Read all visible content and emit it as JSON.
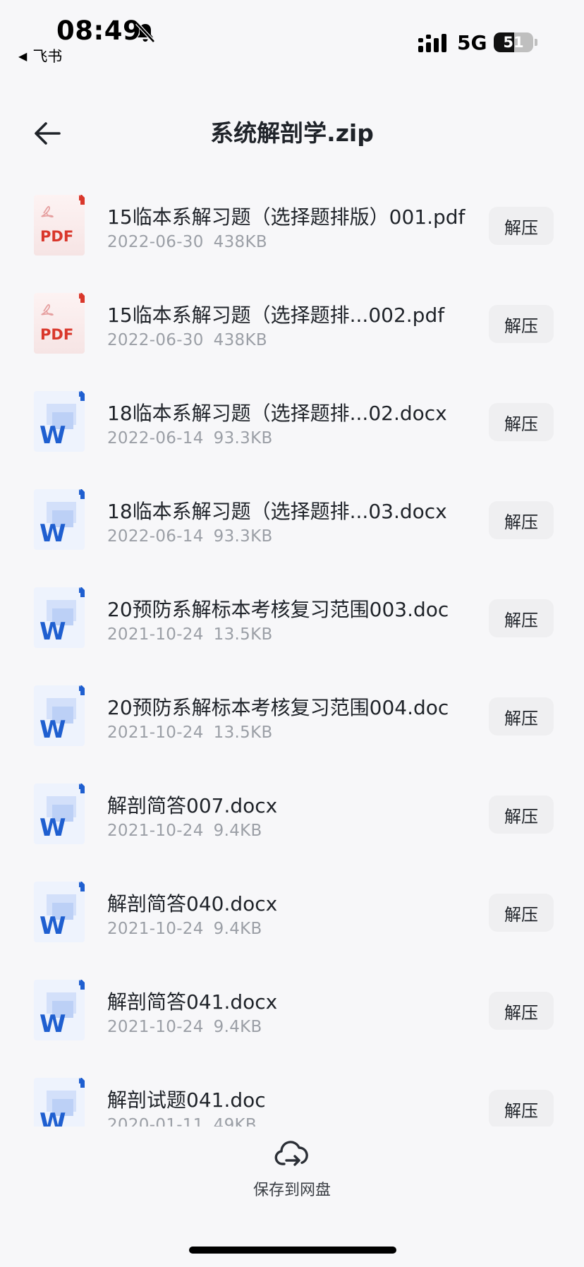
{
  "status_bar": {
    "time": "08:49",
    "back_app": "飞书",
    "network": "5G",
    "battery": "51",
    "battery_level": 0.51
  },
  "header": {
    "title": "系统解剖学.zip"
  },
  "files": [
    {
      "type": "pdf",
      "name": "15临本系解习题（选择题排版）001.pdf",
      "date": "2022-06-30",
      "size": "438KB",
      "action": "解压"
    },
    {
      "type": "pdf",
      "name": "15临本系解习题（选择题排...002.pdf",
      "date": "2022-06-30",
      "size": "438KB",
      "action": "解压"
    },
    {
      "type": "word",
      "name": "18临本系解习题（选择题排...02.docx",
      "date": "2022-06-14",
      "size": "93.3KB",
      "action": "解压"
    },
    {
      "type": "word",
      "name": "18临本系解习题（选择题排...03.docx",
      "date": "2022-06-14",
      "size": "93.3KB",
      "action": "解压"
    },
    {
      "type": "word",
      "name": "20预防系解标本考核复习范围003.doc",
      "date": "2021-10-24",
      "size": "13.5KB",
      "action": "解压"
    },
    {
      "type": "word",
      "name": "20预防系解标本考核复习范围004.doc",
      "date": "2021-10-24",
      "size": "13.5KB",
      "action": "解压"
    },
    {
      "type": "word",
      "name": "解剖简答007.docx",
      "date": "2021-10-24",
      "size": "9.4KB",
      "action": "解压"
    },
    {
      "type": "word",
      "name": "解剖简答040.docx",
      "date": "2021-10-24",
      "size": "9.4KB",
      "action": "解压"
    },
    {
      "type": "word",
      "name": "解剖简答041.docx",
      "date": "2021-10-24",
      "size": "9.4KB",
      "action": "解压"
    },
    {
      "type": "word",
      "name": "解剖试题041.doc",
      "date": "2020-01-11",
      "size": "49KB",
      "action": "解压"
    }
  ],
  "bottom": {
    "save_label": "保存到网盘"
  },
  "icons": {
    "pdf_text": "PDF",
    "word_text": "W"
  },
  "colors": {
    "pdf_red": "#d9372b",
    "word_blue": "#1f5fd0"
  }
}
